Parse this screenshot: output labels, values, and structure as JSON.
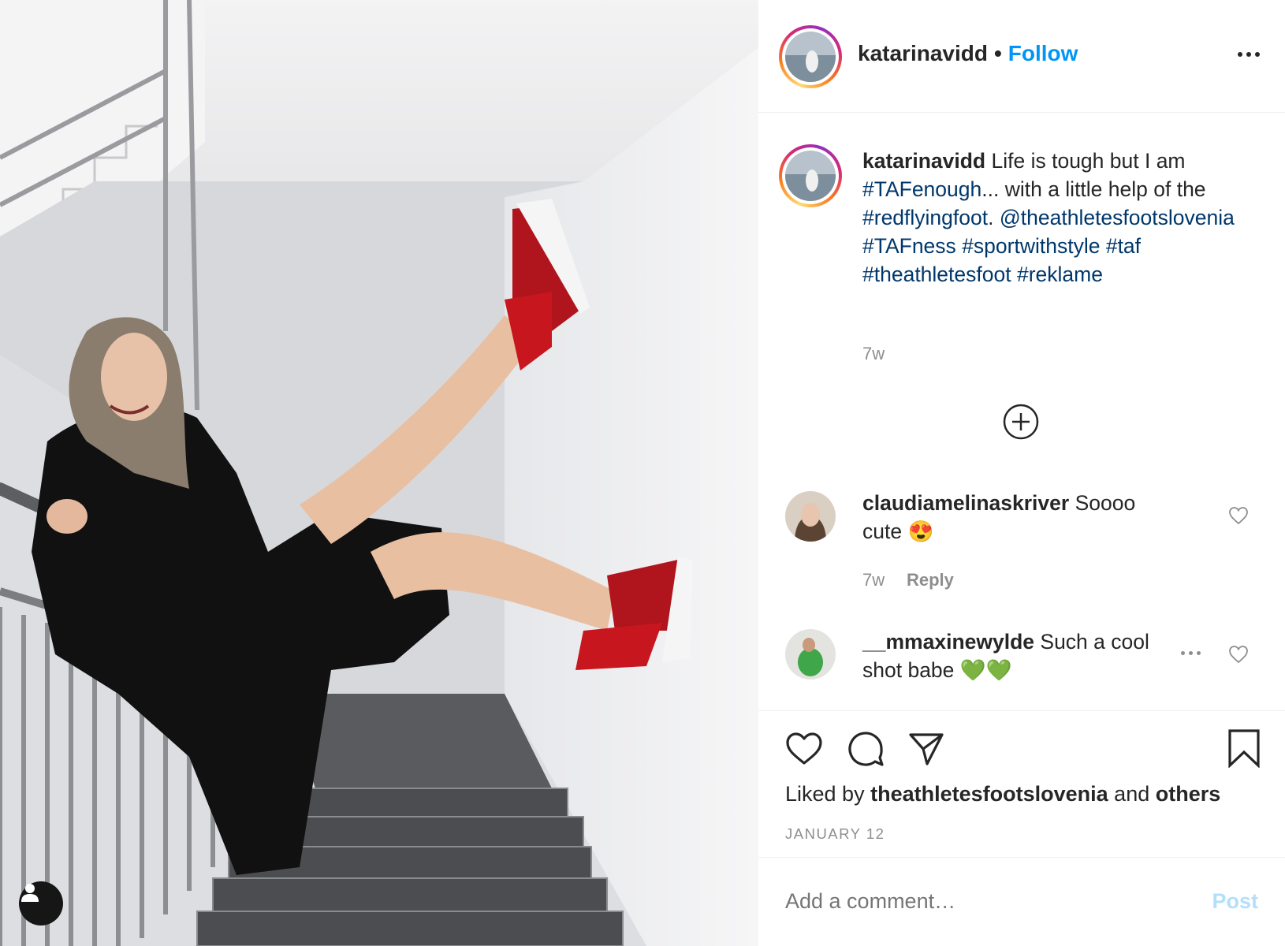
{
  "header": {
    "username": "katarinavidd",
    "separator": "•",
    "follow_label": "Follow",
    "more_icon": "more-horizontal-icon"
  },
  "caption": {
    "username": "katarinavidd",
    "text_1": "Life is tough but I am",
    "hashtag_tafenough": "#TAFenough",
    "text_2": "... with a little help of the",
    "hashtag_redflyingfoot": "#redflyingfoot",
    "text_3": ".",
    "mention": "@theathletesfootslovenia",
    "hashtag_tafness": "#TAFness",
    "hashtag_sportwithstyle": "#sportwithstyle",
    "hashtag_taf": "#taf",
    "hashtag_theathletesfoot": "#theathletesfoot",
    "hashtag_reklame": "#reklame",
    "time": "7w"
  },
  "comments": [
    {
      "username": "claudiamelinaskriver",
      "text": "Soooo cute",
      "emoji": "😍",
      "time": "7w",
      "reply_label": "Reply"
    },
    {
      "username": "__mmaxinewylde",
      "text": "Such a cool shot babe",
      "emoji": "💚💚"
    }
  ],
  "footer": {
    "liked_prefix": "Liked by",
    "liked_user": "theathletesfootslovenia",
    "liked_and": "and",
    "liked_others": "others",
    "date": "JANUARY 12",
    "comment_placeholder": "Add a comment…",
    "post_label": "Post"
  },
  "colors": {
    "follow_blue": "#0095f6",
    "hashtag_blue": "#00376b",
    "muted_gray": "#8e8e8e",
    "post_disabled": "#b2dffc"
  }
}
